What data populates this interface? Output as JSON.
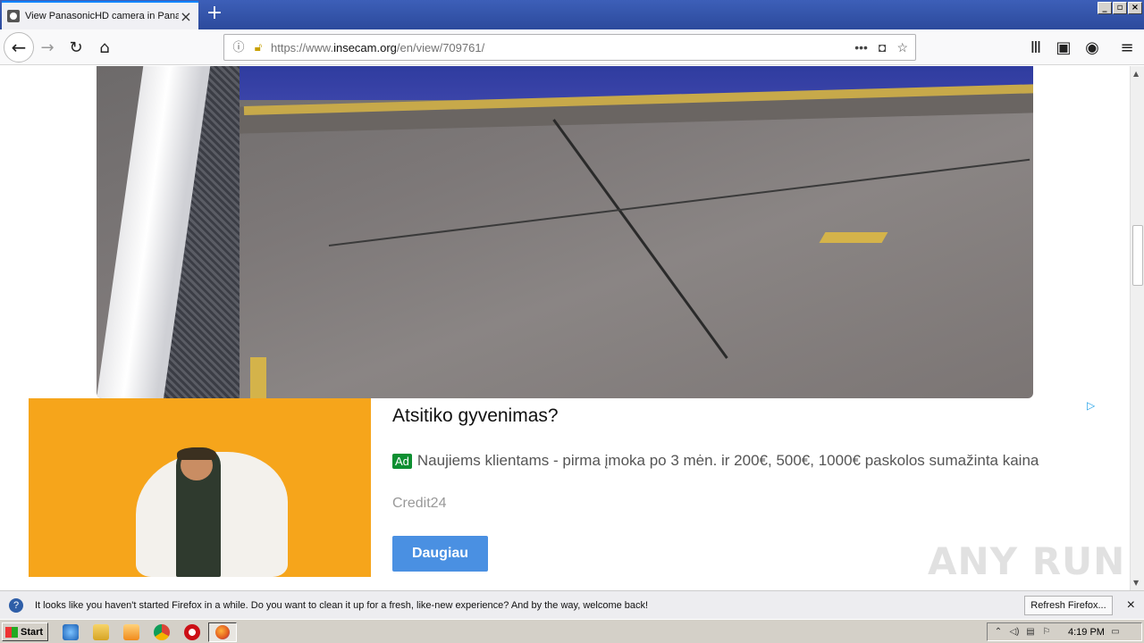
{
  "browser": {
    "tab_title": "View PanasonicHD camera in Panar",
    "url_prefix": "https://www.",
    "url_domain": "insecam.org",
    "url_path": "/en/view/709761/"
  },
  "ad": {
    "title": "Atsitiko gyvenimas?",
    "badge": "Ad",
    "text": "Naujiems klientams - pirma įmoka po 3 mėn. ir 200€, 500€, 1000€ paskolos sumažinta kaina",
    "source": "Credit24",
    "button": "Daugiau"
  },
  "watermark": "ANY RUN",
  "notification": {
    "message": "It looks like you haven't started Firefox in a while. Do you want to clean it up for a fresh, like-new experience? And by the way, welcome back!",
    "button": "Refresh Firefox..."
  },
  "taskbar": {
    "start": "Start",
    "clock": "4:19 PM"
  }
}
